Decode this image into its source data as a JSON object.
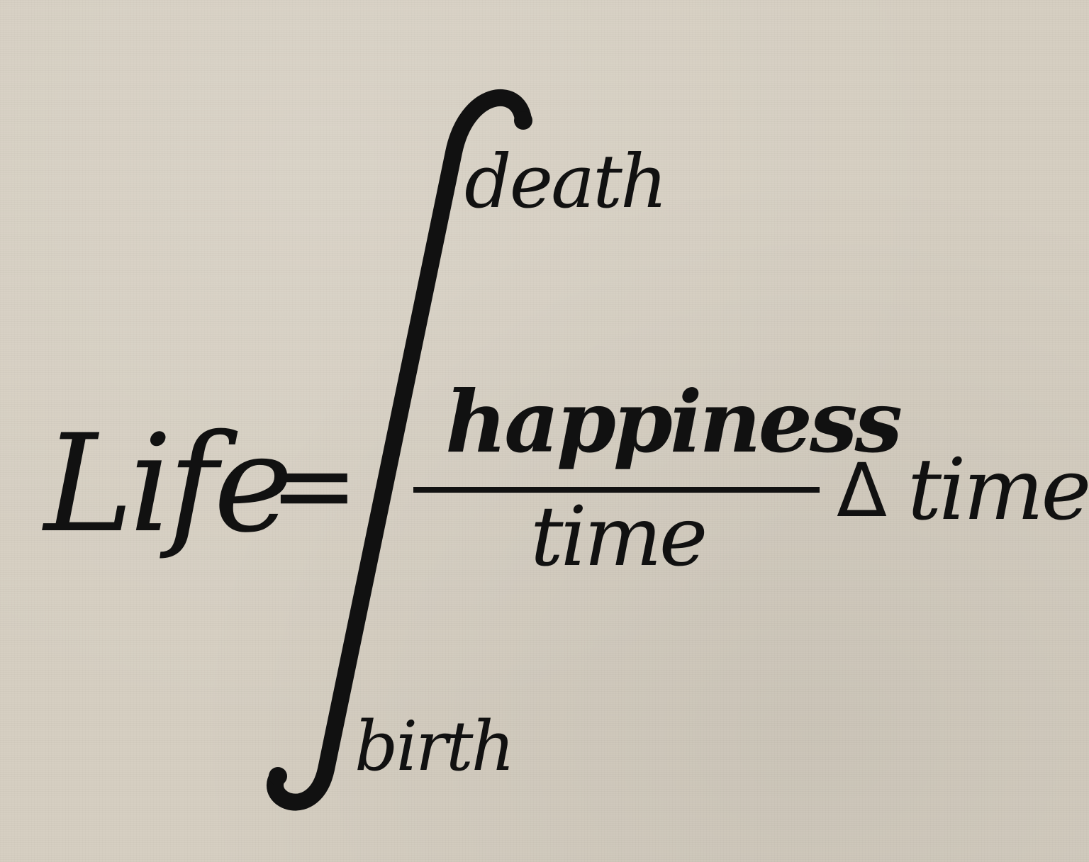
{
  "equation": {
    "lhs": "Life",
    "equals": "=",
    "upper_limit": "death",
    "lower_limit": "birth",
    "numerator": "happiness",
    "denominator": "time",
    "delta": "Δ",
    "variable": "time"
  },
  "colors": {
    "paper": "#d6cfc2",
    "ink": "#111111"
  },
  "icons": {
    "integral": "integral-sign-icon"
  }
}
